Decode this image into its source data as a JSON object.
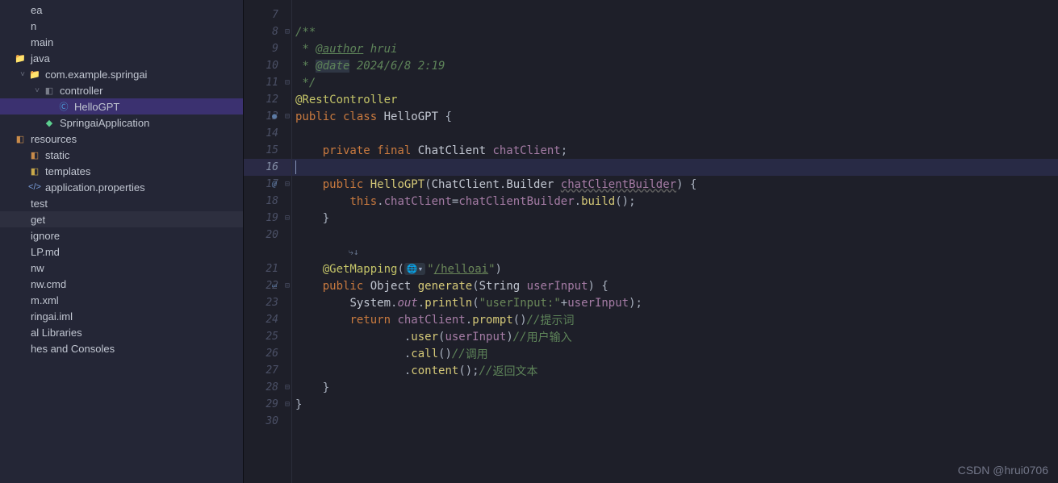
{
  "sidebar": {
    "items": [
      {
        "indent": 0,
        "arrow": "",
        "icon": "",
        "iconClass": "",
        "label": "ea",
        "cls": ""
      },
      {
        "indent": 0,
        "arrow": "",
        "icon": "",
        "iconClass": "",
        "label": "n",
        "cls": ""
      },
      {
        "indent": 0,
        "arrow": "",
        "icon": "",
        "iconClass": "",
        "label": "main",
        "cls": ""
      },
      {
        "indent": 0,
        "arrow": "",
        "icon": "📁",
        "iconClass": "ic-folder",
        "label": "java",
        "cls": ""
      },
      {
        "indent": 1,
        "arrow": "˅",
        "icon": "📁",
        "iconClass": "ic-folder",
        "label": "com.example.springai",
        "cls": ""
      },
      {
        "indent": 2,
        "arrow": "˅",
        "icon": "◧",
        "iconClass": "ic-pkg",
        "label": "controller",
        "cls": ""
      },
      {
        "indent": 3,
        "arrow": "",
        "icon": "Ⓒ",
        "iconClass": "ic-class",
        "label": "HelloGPT",
        "cls": "selected"
      },
      {
        "indent": 2,
        "arrow": "",
        "icon": "◆",
        "iconClass": "ic-app",
        "label": "SpringaiApplication",
        "cls": ""
      },
      {
        "indent": 0,
        "arrow": "",
        "icon": "◧",
        "iconClass": "ic-res",
        "label": "resources",
        "cls": ""
      },
      {
        "indent": 1,
        "arrow": "",
        "icon": "◧",
        "iconClass": "ic-res",
        "label": "static",
        "cls": ""
      },
      {
        "indent": 1,
        "arrow": "",
        "icon": "◧",
        "iconClass": "ic-tpl",
        "label": "templates",
        "cls": ""
      },
      {
        "indent": 1,
        "arrow": "",
        "icon": "</>",
        "iconClass": "ic-props",
        "label": "application.properties",
        "cls": ""
      },
      {
        "indent": 0,
        "arrow": "",
        "icon": "",
        "iconClass": "",
        "label": "test",
        "cls": ""
      },
      {
        "indent": 0,
        "arrow": "",
        "icon": "",
        "iconClass": "",
        "label": "get",
        "cls": "hl"
      },
      {
        "indent": 0,
        "arrow": "",
        "icon": "",
        "iconClass": "",
        "label": "ignore",
        "cls": ""
      },
      {
        "indent": 0,
        "arrow": "",
        "icon": "",
        "iconClass": "",
        "label": "LP.md",
        "cls": ""
      },
      {
        "indent": 0,
        "arrow": "",
        "icon": "",
        "iconClass": "",
        "label": "nw",
        "cls": ""
      },
      {
        "indent": 0,
        "arrow": "",
        "icon": "",
        "iconClass": "",
        "label": "nw.cmd",
        "cls": ""
      },
      {
        "indent": 0,
        "arrow": "",
        "icon": "",
        "iconClass": "",
        "label": "m.xml",
        "cls": ""
      },
      {
        "indent": 0,
        "arrow": "",
        "icon": "",
        "iconClass": "",
        "label": "ringai.iml",
        "cls": ""
      },
      {
        "indent": 0,
        "arrow": "",
        "icon": "",
        "iconClass": "",
        "label": "al Libraries",
        "cls": ""
      },
      {
        "indent": 0,
        "arrow": "",
        "icon": "",
        "iconClass": "",
        "label": "hes and Consoles",
        "cls": ""
      }
    ]
  },
  "gutter": {
    "lines": [
      {
        "n": "7",
        "fold": "",
        "marker": "",
        "hl": false
      },
      {
        "n": "8",
        "fold": "⊟",
        "marker": "",
        "hl": false
      },
      {
        "n": "9",
        "fold": "",
        "marker": "",
        "hl": false
      },
      {
        "n": "10",
        "fold": "",
        "marker": "",
        "hl": false
      },
      {
        "n": "11",
        "fold": "⊟",
        "marker": "",
        "hl": false
      },
      {
        "n": "12",
        "fold": "",
        "marker": "",
        "hl": false
      },
      {
        "n": "13",
        "fold": "⊟",
        "marker": "●",
        "hl": false
      },
      {
        "n": "14",
        "fold": "",
        "marker": "",
        "hl": false
      },
      {
        "n": "15",
        "fold": "",
        "marker": "",
        "hl": false
      },
      {
        "n": "16",
        "fold": "",
        "marker": "",
        "hl": true
      },
      {
        "n": "17",
        "fold": "⊟",
        "marker": "@",
        "hl": false
      },
      {
        "n": "18",
        "fold": "",
        "marker": "",
        "hl": false
      },
      {
        "n": "19",
        "fold": "⊟",
        "marker": "",
        "hl": false
      },
      {
        "n": "20",
        "fold": "",
        "marker": "",
        "hl": false
      },
      {
        "n": "",
        "fold": "",
        "marker": "",
        "hl": false
      },
      {
        "n": "21",
        "fold": "",
        "marker": "",
        "hl": false
      },
      {
        "n": "22",
        "fold": "⊟",
        "marker": "▭",
        "hl": false
      },
      {
        "n": "23",
        "fold": "",
        "marker": "",
        "hl": false
      },
      {
        "n": "24",
        "fold": "",
        "marker": "",
        "hl": false
      },
      {
        "n": "25",
        "fold": "",
        "marker": "",
        "hl": false
      },
      {
        "n": "26",
        "fold": "",
        "marker": "",
        "hl": false
      },
      {
        "n": "27",
        "fold": "",
        "marker": "",
        "hl": false
      },
      {
        "n": "28",
        "fold": "⊟",
        "marker": "",
        "hl": false
      },
      {
        "n": "29",
        "fold": "⊟",
        "marker": "",
        "hl": false
      },
      {
        "n": "30",
        "fold": "",
        "marker": "",
        "hl": false
      }
    ]
  },
  "code": {
    "lines": [
      {
        "hl": false,
        "spans": []
      },
      {
        "hl": false,
        "spans": [
          {
            "t": "/**",
            "c": "cmt"
          }
        ]
      },
      {
        "hl": false,
        "spans": [
          {
            "t": " * ",
            "c": "cmt"
          },
          {
            "t": "@author",
            "c": "ann-tag"
          },
          {
            "t": " hrui",
            "c": "cmt"
          }
        ]
      },
      {
        "hl": false,
        "spans": [
          {
            "t": " * ",
            "c": "cmt"
          },
          {
            "t": "@date",
            "c": "ann-tag2"
          },
          {
            "t": " 2024/6/8 2:19",
            "c": "cmt"
          }
        ]
      },
      {
        "hl": false,
        "spans": [
          {
            "t": " */",
            "c": "cmt"
          }
        ]
      },
      {
        "hl": false,
        "spans": [
          {
            "t": "@RestController",
            "c": "ann"
          }
        ]
      },
      {
        "hl": false,
        "spans": [
          {
            "t": "public class ",
            "c": "kw"
          },
          {
            "t": "HelloGPT",
            "c": "cls"
          },
          {
            "t": " {",
            "c": "pln"
          }
        ]
      },
      {
        "hl": false,
        "spans": []
      },
      {
        "hl": false,
        "spans": [
          {
            "t": "    ",
            "c": ""
          },
          {
            "t": "private final ",
            "c": "kw"
          },
          {
            "t": "ChatClient ",
            "c": "cls"
          },
          {
            "t": "chatClient",
            "c": "id"
          },
          {
            "t": ";",
            "c": "pln"
          }
        ]
      },
      {
        "hl": true,
        "caret": true,
        "spans": []
      },
      {
        "hl": false,
        "spans": [
          {
            "t": "    ",
            "c": ""
          },
          {
            "t": "public ",
            "c": "kw"
          },
          {
            "t": "HelloGPT",
            "c": "mth"
          },
          {
            "t": "(",
            "c": "pln"
          },
          {
            "t": "ChatClient",
            "c": "cls"
          },
          {
            "t": ".",
            "c": "pln"
          },
          {
            "t": "Builder ",
            "c": "cls"
          },
          {
            "t": "chatClientBuilder",
            "c": "par"
          },
          {
            "t": ")",
            "c": "pln"
          },
          {
            "t": " {",
            "c": "pln"
          }
        ]
      },
      {
        "hl": false,
        "spans": [
          {
            "t": "        ",
            "c": ""
          },
          {
            "t": "this",
            "c": "kw"
          },
          {
            "t": ".",
            "c": "pln"
          },
          {
            "t": "chatClient",
            "c": "id"
          },
          {
            "t": "=",
            "c": "pln"
          },
          {
            "t": "chatClientBuilder",
            "c": "id"
          },
          {
            "t": ".",
            "c": "pln"
          },
          {
            "t": "build",
            "c": "mth"
          },
          {
            "t": "();",
            "c": "pln"
          }
        ]
      },
      {
        "hl": false,
        "spans": [
          {
            "t": "    }",
            "c": "pln"
          }
        ]
      },
      {
        "hl": false,
        "spans": []
      },
      {
        "hl": false,
        "inlay_row": true,
        "spans": [
          {
            "t": "    ",
            "c": ""
          },
          {
            "t": "⤷↓",
            "c": "inlay-glyphs"
          }
        ]
      },
      {
        "hl": false,
        "spans": [
          {
            "t": "    ",
            "c": ""
          },
          {
            "t": "@GetMapping",
            "c": "ann"
          },
          {
            "t": "(",
            "c": "pln"
          },
          {
            "t": "🌐▾",
            "c": "",
            "inlay": true
          },
          {
            "t": "\"",
            "c": "str"
          },
          {
            "t": "/helloai",
            "c": "url"
          },
          {
            "t": "\"",
            "c": "str"
          },
          {
            "t": ")",
            "c": "pln"
          }
        ]
      },
      {
        "hl": false,
        "spans": [
          {
            "t": "    ",
            "c": ""
          },
          {
            "t": "public ",
            "c": "kw"
          },
          {
            "t": "Object ",
            "c": "cls"
          },
          {
            "t": "generate",
            "c": "mth"
          },
          {
            "t": "(",
            "c": "pln"
          },
          {
            "t": "String ",
            "c": "cls"
          },
          {
            "t": "userInput",
            "c": "id"
          },
          {
            "t": ")",
            "c": "pln"
          },
          {
            "t": " {",
            "c": "pln"
          }
        ]
      },
      {
        "hl": false,
        "spans": [
          {
            "t": "        ",
            "c": ""
          },
          {
            "t": "System",
            "c": "cls"
          },
          {
            "t": ".",
            "c": "pln"
          },
          {
            "t": "out",
            "c": "id",
            "italic": true
          },
          {
            "t": ".",
            "c": "pln"
          },
          {
            "t": "println",
            "c": "mth"
          },
          {
            "t": "(",
            "c": "pln"
          },
          {
            "t": "\"userInput:\"",
            "c": "str"
          },
          {
            "t": "+",
            "c": "pln"
          },
          {
            "t": "userInput",
            "c": "id"
          },
          {
            "t": ");",
            "c": "pln"
          }
        ]
      },
      {
        "hl": false,
        "spans": [
          {
            "t": "        ",
            "c": ""
          },
          {
            "t": "return ",
            "c": "kw"
          },
          {
            "t": "chatClient",
            "c": "id"
          },
          {
            "t": ".",
            "c": "pln"
          },
          {
            "t": "prompt",
            "c": "mth"
          },
          {
            "t": "()",
            "c": "pln"
          },
          {
            "t": "//",
            "c": "cmt"
          },
          {
            "t": "提示词",
            "c": "cmt cmt-cn"
          }
        ]
      },
      {
        "hl": false,
        "spans": [
          {
            "t": "                .",
            "c": "pln"
          },
          {
            "t": "user",
            "c": "mth"
          },
          {
            "t": "(",
            "c": "pln"
          },
          {
            "t": "userInput",
            "c": "id"
          },
          {
            "t": ")",
            "c": "pln"
          },
          {
            "t": "//",
            "c": "cmt"
          },
          {
            "t": "用户输入",
            "c": "cmt cmt-cn"
          }
        ]
      },
      {
        "hl": false,
        "spans": [
          {
            "t": "                .",
            "c": "pln"
          },
          {
            "t": "call",
            "c": "mth"
          },
          {
            "t": "()",
            "c": "pln"
          },
          {
            "t": "//",
            "c": "cmt"
          },
          {
            "t": "调用",
            "c": "cmt cmt-cn"
          }
        ]
      },
      {
        "hl": false,
        "spans": [
          {
            "t": "                .",
            "c": "pln"
          },
          {
            "t": "content",
            "c": "mth"
          },
          {
            "t": "();",
            "c": "pln"
          },
          {
            "t": "//",
            "c": "cmt"
          },
          {
            "t": "返回文本",
            "c": "cmt cmt-cn"
          }
        ]
      },
      {
        "hl": false,
        "spans": [
          {
            "t": "    }",
            "c": "pln"
          }
        ]
      },
      {
        "hl": false,
        "spans": [
          {
            "t": "}",
            "c": "pln"
          }
        ]
      },
      {
        "hl": false,
        "spans": []
      }
    ]
  },
  "watermark": "CSDN @hrui0706"
}
